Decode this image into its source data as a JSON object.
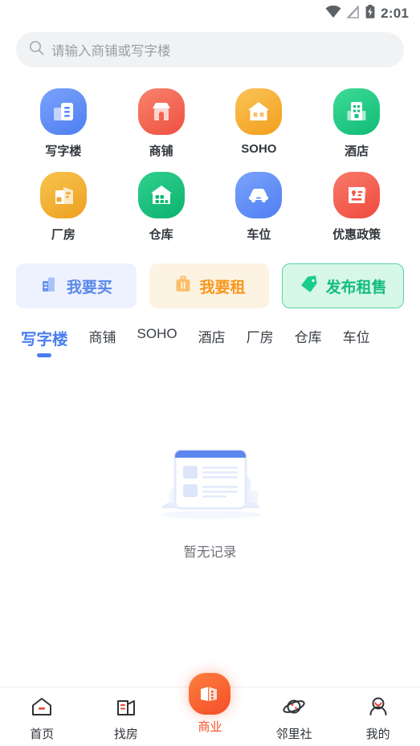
{
  "statusbar": {
    "time": "2:01",
    "icons": [
      "wifi-icon",
      "signal-off-icon",
      "battery-charging-icon"
    ]
  },
  "search": {
    "placeholder": "请输入商铺或写字楼",
    "value": "",
    "icon": "search-icon"
  },
  "categories": [
    {
      "label": "写字楼",
      "icon": "office-building-icon",
      "color": "#5b8cf5",
      "color2": "#7ba4fb"
    },
    {
      "label": "商铺",
      "icon": "shop-storefront-icon",
      "color": "#f2614f",
      "color2": "#f77b63"
    },
    {
      "label": "SOHO",
      "icon": "house-soho-icon",
      "color": "#f5a524",
      "color2": "#fac04f"
    },
    {
      "label": "酒店",
      "icon": "hotel-icon",
      "color": "#15c37e",
      "color2": "#3ddb97"
    },
    {
      "label": "厂房",
      "icon": "factory-icon",
      "color": "#f0a62c",
      "color2": "#f8c44f"
    },
    {
      "label": "仓库",
      "icon": "warehouse-icon",
      "color": "#11b873",
      "color2": "#2fd08d"
    },
    {
      "label": "车位",
      "icon": "car-parking-icon",
      "color": "#5b8cf5",
      "color2": "#7ba4fb"
    },
    {
      "label": "优惠政策",
      "icon": "policy-card-icon",
      "color": "#f2564a",
      "color2": "#f87a6a"
    }
  ],
  "actions": [
    {
      "label": "我要买",
      "icon": "building-buy-icon",
      "accent": "#5a87ea",
      "bg": "#eef2fe"
    },
    {
      "label": "我要租",
      "icon": "suitcase-rent-icon",
      "accent": "#f7971d",
      "bg": "#fdf3e3"
    },
    {
      "label": "发布租售",
      "icon": "price-tag-icon",
      "accent": "#13bd7f",
      "bg": "#d7f7e8"
    }
  ],
  "tabs": [
    {
      "label": "写字楼",
      "active": true
    },
    {
      "label": "商铺",
      "active": false
    },
    {
      "label": "SOHO",
      "active": false
    },
    {
      "label": "酒店",
      "active": false
    },
    {
      "label": "厂房",
      "active": false
    },
    {
      "label": "仓库",
      "active": false
    },
    {
      "label": "车位",
      "active": false
    }
  ],
  "empty_state": {
    "text": "暂无记录",
    "illustration": "empty-document-illustration"
  },
  "bottom_nav": {
    "active_color": "#f4522a",
    "items": [
      {
        "label": "首页",
        "icon": "home-icon",
        "active": false
      },
      {
        "label": "找房",
        "icon": "find-house-icon",
        "active": false
      },
      {
        "label": "商业",
        "icon": "business-icon",
        "active": true
      },
      {
        "label": "邻里社",
        "icon": "planet-icon",
        "active": false
      },
      {
        "label": "我的",
        "icon": "user-avatar-icon",
        "active": false
      }
    ]
  }
}
